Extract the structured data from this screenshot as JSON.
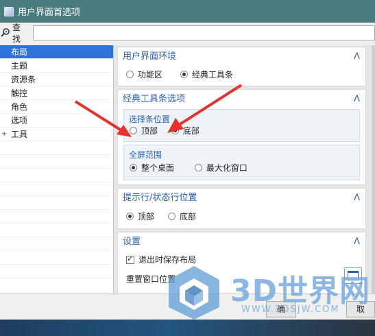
{
  "window": {
    "title": "用户界面首选项"
  },
  "search": {
    "label": "查找",
    "value": ""
  },
  "tree": {
    "items": [
      {
        "label": "布局",
        "selected": true,
        "expander": ""
      },
      {
        "label": "主题",
        "selected": false,
        "expander": ""
      },
      {
        "label": "资源条",
        "selected": false,
        "expander": ""
      },
      {
        "label": "触控",
        "selected": false,
        "expander": ""
      },
      {
        "label": "角色",
        "selected": false,
        "expander": ""
      },
      {
        "label": "选项",
        "selected": false,
        "expander": ""
      },
      {
        "label": "工具",
        "selected": false,
        "expander": "+"
      }
    ]
  },
  "sections": {
    "env": {
      "title": "用户界面环境",
      "options": [
        "功能区",
        "经典工具条"
      ],
      "selected": 1
    },
    "classic": {
      "title": "经典工具条选项",
      "bar_position": {
        "title": "选择条位置",
        "options": [
          "顶部",
          "底部"
        ],
        "selected": 1
      },
      "fullscreen": {
        "title": "全屏范围",
        "options": [
          "整个桌面",
          "最大化窗口"
        ],
        "selected": 0
      }
    },
    "cue": {
      "title": "提示行/状态行位置",
      "options": [
        "顶部",
        "底部"
      ],
      "selected": 0
    },
    "settings": {
      "title": "设置",
      "save_on_exit": "退出时保存布局",
      "save_checked": true,
      "reset_label": "重置窗口位置"
    }
  },
  "footer": {
    "ok_label": "确",
    "cancel_label": "取"
  },
  "watermark": {
    "text": "3D世界网",
    "url": "WWW.3DSJW.COM"
  },
  "colors": {
    "titlebar": "#4a7d7d",
    "selected": "#2f73d8",
    "section_title": "#2b5fb3",
    "arrow": "#e8312f"
  }
}
